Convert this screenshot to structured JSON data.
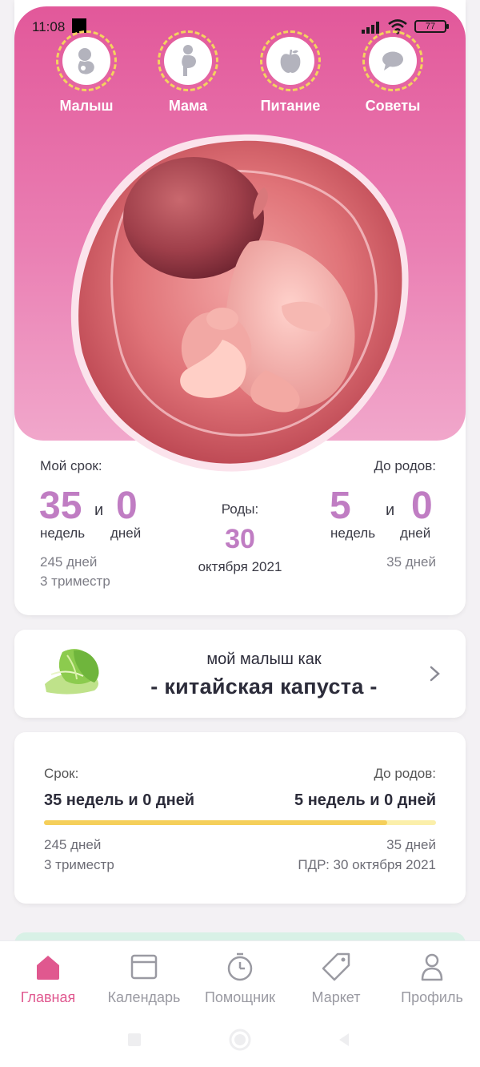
{
  "status_bar": {
    "time": "11:08",
    "battery": "77"
  },
  "top_nav": [
    {
      "label": "Малыш",
      "icon": "baby-icon"
    },
    {
      "label": "Мама",
      "icon": "pregnant-mom-icon"
    },
    {
      "label": "Питание",
      "icon": "apple-icon"
    },
    {
      "label": "Советы",
      "icon": "chat-bubble-icon"
    }
  ],
  "stats": {
    "my_term_label": "Мой срок:",
    "weeks": "35",
    "and_word": "и",
    "days": "0",
    "weeks_unit": "недель",
    "days_unit": "дней",
    "total_days": "245 дней",
    "trimester": "3 триместр",
    "birth_label": "Роды:",
    "birth_day": "30",
    "birth_month_year": "октября 2021",
    "until_birth_label": "До родов:",
    "left_weeks": "5",
    "left_days": "0",
    "left_total_days": "35 дней"
  },
  "size_card": {
    "prefix": "мой малыш как",
    "name": "- китайская капуста -"
  },
  "progress_card": {
    "term_label": "Срок:",
    "term_value": "35 недель и 0 дней",
    "until_label": "До родов:",
    "until_value": "5 недель и 0 дней",
    "progress_fraction": 0.875,
    "days": "245 дней",
    "trimester": "3 триместр",
    "days_left": "35 дней",
    "due_date": "ПДР: 30 октября 2021"
  },
  "tabs": [
    {
      "label": "Главная",
      "icon": "home-icon",
      "active": true
    },
    {
      "label": "Календарь",
      "icon": "calendar-icon",
      "active": false
    },
    {
      "label": "Помощник",
      "icon": "timer-icon",
      "active": false
    },
    {
      "label": "Маркет",
      "icon": "tag-icon",
      "active": false
    },
    {
      "label": "Профиль",
      "icon": "profile-icon",
      "active": false
    }
  ],
  "colors": {
    "brand_pink": "#e2589a",
    "accent_purple": "#c07dc3",
    "progress_yellow": "#f5cf5a",
    "active_tab": "#e0588f"
  }
}
